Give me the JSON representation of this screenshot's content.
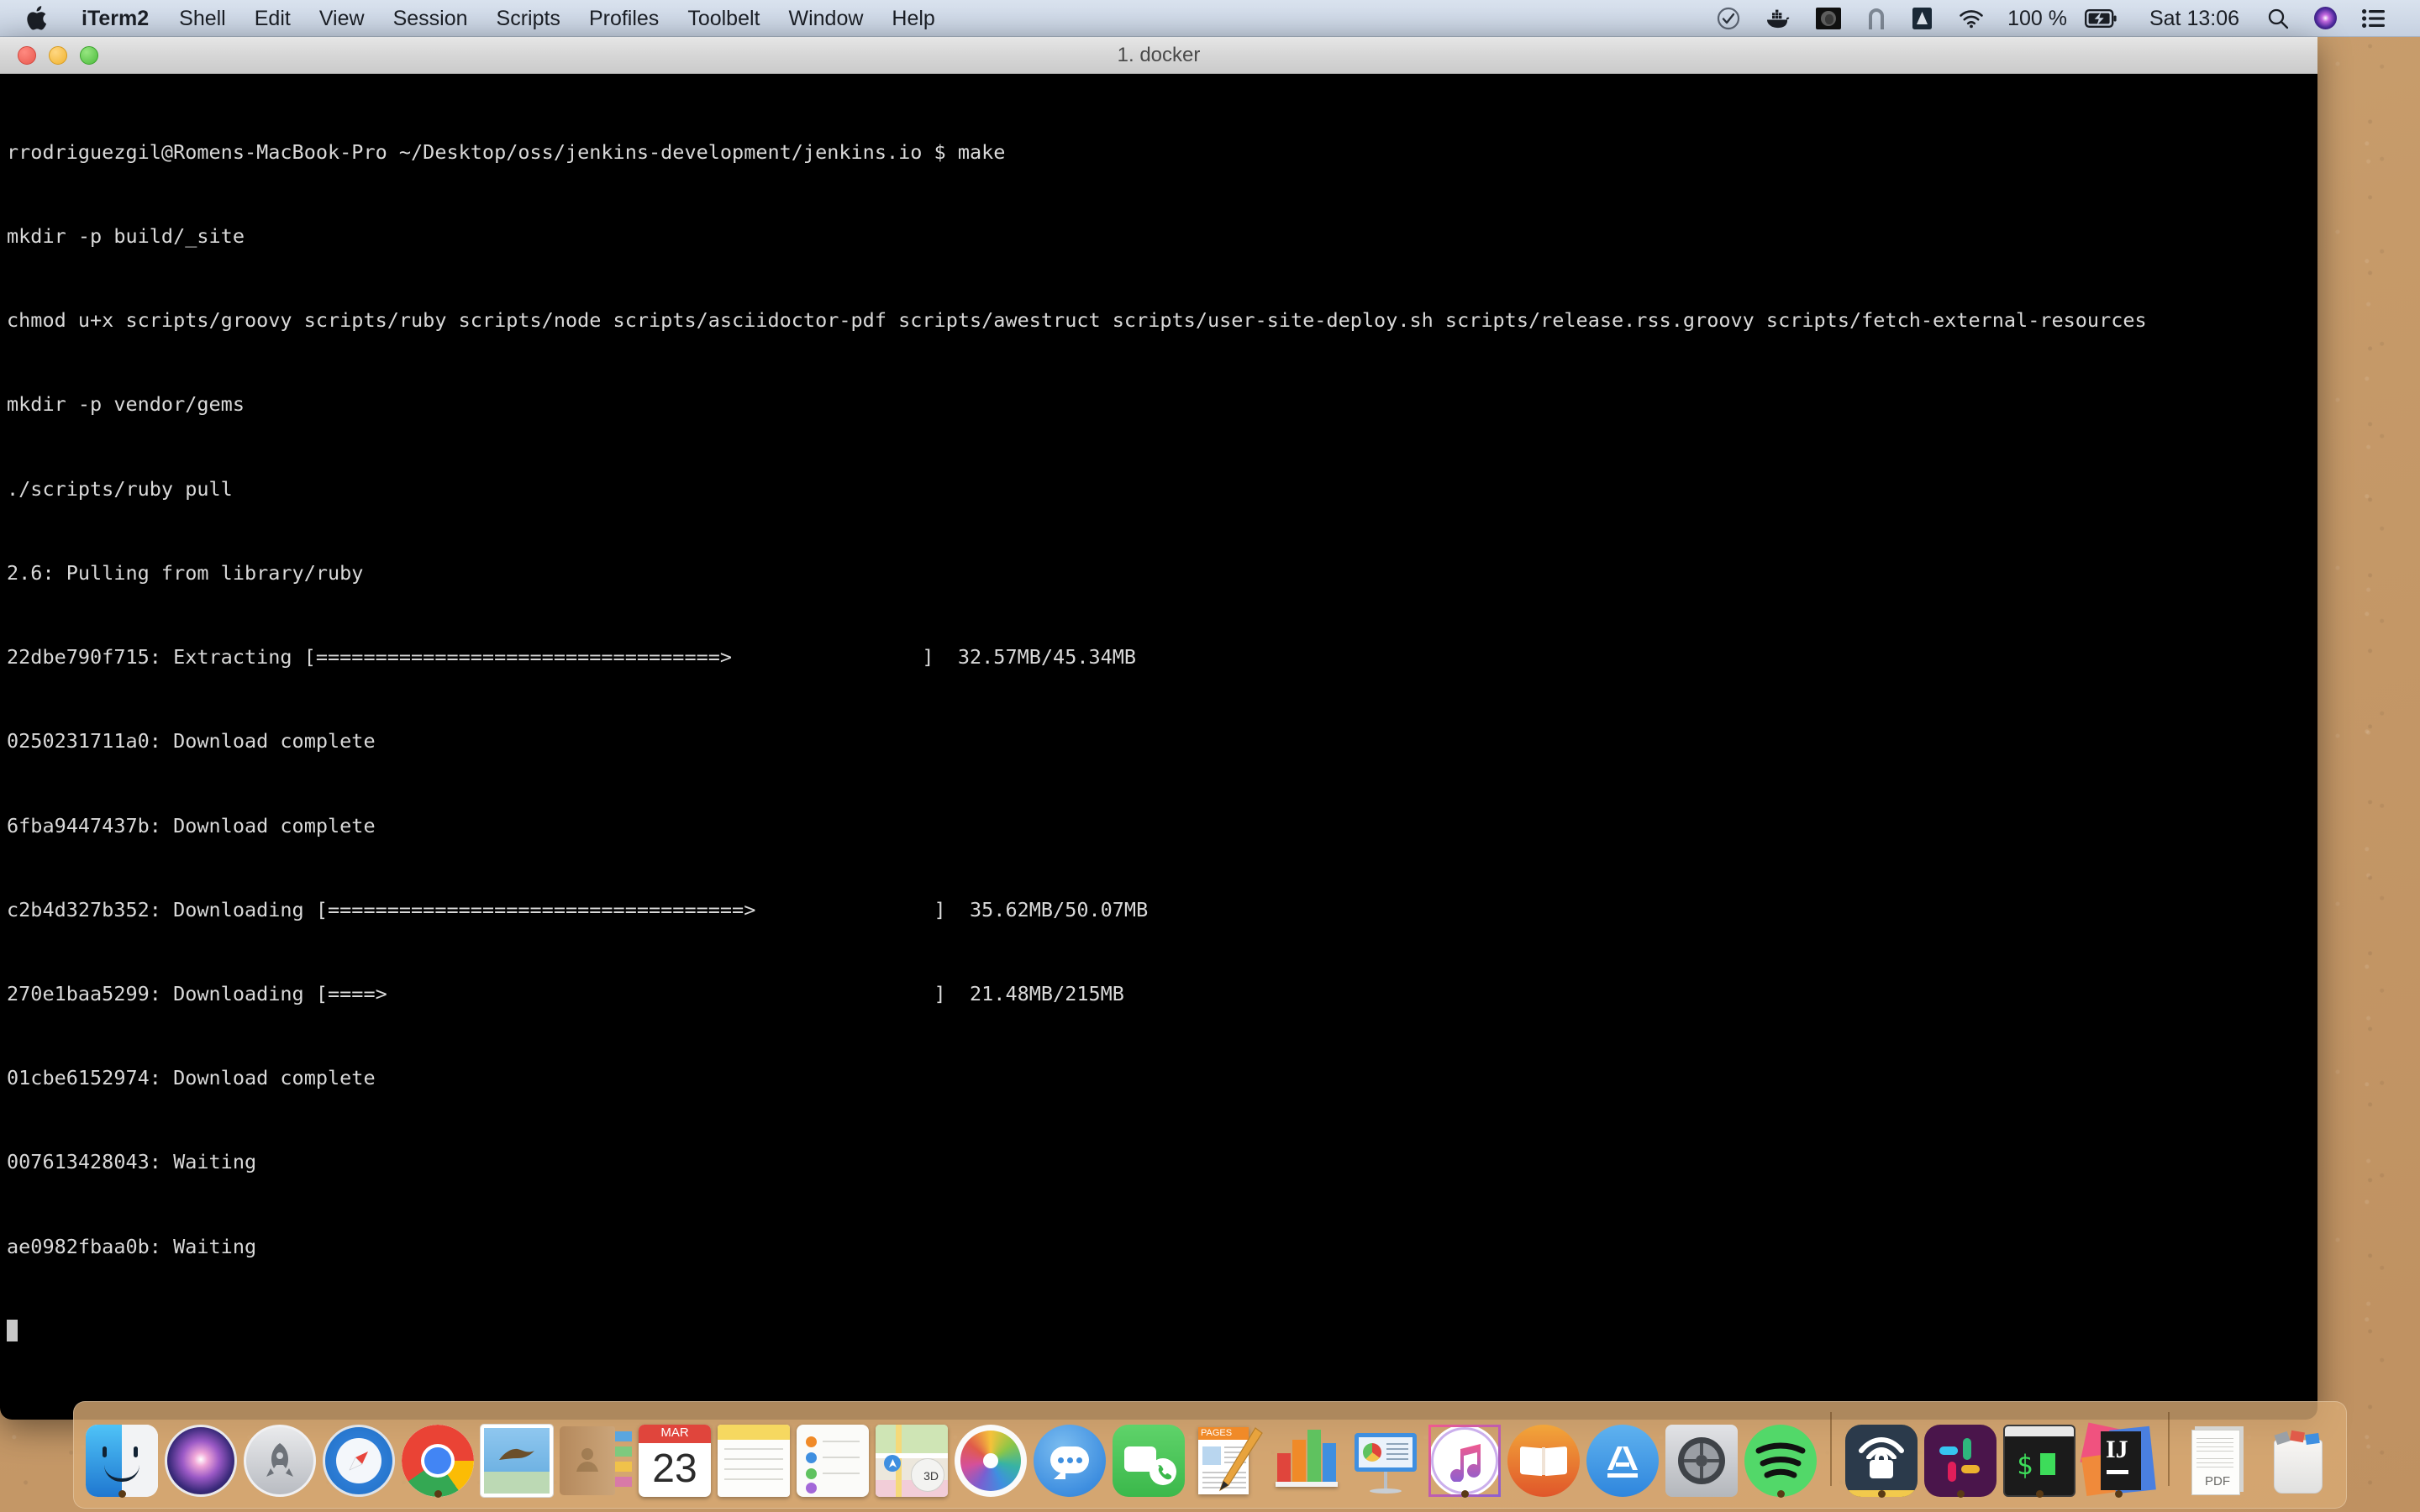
{
  "menubar": {
    "apple_icon": "apple-logo-icon",
    "app_name": "iTerm2",
    "items": [
      "Shell",
      "Edit",
      "View",
      "Session",
      "Scripts",
      "Profiles",
      "Toolbelt",
      "Window",
      "Help"
    ],
    "status_icons": [
      "tick-circle-icon",
      "docker-whale-icon",
      "screenshot-thumbnail-icon",
      "arc-browser-icon",
      "google-drive-icon",
      "wifi-icon"
    ],
    "battery_percent": "100 %",
    "battery_icon": "battery-charging-icon",
    "clock": "Sat 13:06",
    "search_icon": "spotlight-search-icon",
    "siri_icon": "siri-icon",
    "control_center_icon": "notification-center-icon"
  },
  "window": {
    "title": "1. docker",
    "close_button": "close-window-button",
    "minimize_button": "minimize-window-button",
    "zoom_button": "zoom-window-button"
  },
  "terminal": {
    "lines": [
      "rrodriguezgil@Romens-MacBook-Pro ~/Desktop/oss/jenkins-development/jenkins.io $ make",
      "mkdir -p build/_site",
      "chmod u+x scripts/groovy scripts/ruby scripts/node scripts/asciidoctor-pdf scripts/awestruct scripts/user-site-deploy.sh scripts/release.rss.groovy scripts/fetch-external-resources",
      "mkdir -p vendor/gems",
      "./scripts/ruby pull",
      "2.6: Pulling from library/ruby",
      "22dbe790f715: Extracting [==================================>                ]  32.57MB/45.34MB",
      "0250231711a0: Download complete",
      "6fba9447437b: Download complete",
      "c2b4d327b352: Downloading [===================================>               ]  35.62MB/50.07MB",
      "270e1baa5299: Downloading [====>                                              ]  21.48MB/215MB",
      "01cbe6152974: Download complete",
      "007613428043: Waiting",
      "ae0982fbaa0b: Waiting"
    ],
    "prompt_user_host": "rrodriguezgil@Romens-MacBook-Pro",
    "prompt_path": "~/Desktop/oss/jenkins-development/jenkins.io",
    "prompt_symbol": "$",
    "command": "make",
    "pull_image": "2.6",
    "pull_source": "library/ruby",
    "layers": [
      {
        "id": "22dbe790f715",
        "status": "Extracting",
        "progress_pct": 72,
        "downloaded": "32.57MB",
        "total": "45.34MB"
      },
      {
        "id": "0250231711a0",
        "status": "Download complete",
        "progress_pct": null,
        "downloaded": "",
        "total": ""
      },
      {
        "id": "6fba9447437b",
        "status": "Download complete",
        "progress_pct": null,
        "downloaded": "",
        "total": ""
      },
      {
        "id": "c2b4d327b352",
        "status": "Downloading",
        "progress_pct": 71,
        "downloaded": "35.62MB",
        "total": "50.07MB"
      },
      {
        "id": "270e1baa5299",
        "status": "Downloading",
        "progress_pct": 10,
        "downloaded": "21.48MB",
        "total": "215MB"
      },
      {
        "id": "01cbe6152974",
        "status": "Download complete",
        "progress_pct": null,
        "downloaded": "",
        "total": ""
      },
      {
        "id": "007613428043",
        "status": "Waiting",
        "progress_pct": null,
        "downloaded": "",
        "total": ""
      },
      {
        "id": "ae0982fbaa0b",
        "status": "Waiting",
        "progress_pct": null,
        "downloaded": "",
        "total": ""
      }
    ],
    "cursor": "block-cursor"
  },
  "dock": {
    "items": [
      {
        "name": "finder",
        "label": "Finder",
        "icon": "finder-icon",
        "running": true
      },
      {
        "name": "siri",
        "label": "Siri",
        "icon": "siri-icon",
        "running": false
      },
      {
        "name": "launchpad",
        "label": "Launchpad",
        "icon": "launchpad-icon",
        "running": false
      },
      {
        "name": "safari",
        "label": "Safari",
        "icon": "safari-compass-icon",
        "running": false
      },
      {
        "name": "chrome",
        "label": "Google Chrome",
        "icon": "chrome-icon",
        "running": true
      },
      {
        "name": "mail",
        "label": "Mail",
        "icon": "mail-stamp-icon",
        "running": false
      },
      {
        "name": "contacts",
        "label": "Contacts",
        "icon": "contacts-book-icon",
        "running": false
      },
      {
        "name": "calendar",
        "label": "Calendar",
        "icon": "calendar-icon",
        "running": false,
        "month": "MAR",
        "day": "23"
      },
      {
        "name": "notes",
        "label": "Notes",
        "icon": "notes-icon",
        "running": false
      },
      {
        "name": "reminders",
        "label": "Reminders",
        "icon": "reminders-icon",
        "running": false
      },
      {
        "name": "maps",
        "label": "Maps",
        "icon": "maps-icon",
        "running": false
      },
      {
        "name": "photos",
        "label": "Photos",
        "icon": "photos-pinwheel-icon",
        "running": false
      },
      {
        "name": "messages",
        "label": "Messages",
        "icon": "messages-bubble-icon",
        "running": false
      },
      {
        "name": "facetime",
        "label": "FaceTime",
        "icon": "facetime-icon",
        "running": false
      },
      {
        "name": "pages",
        "label": "Pages",
        "icon": "pages-icon",
        "running": false
      },
      {
        "name": "numbers",
        "label": "Numbers",
        "icon": "numbers-chart-icon",
        "running": false
      },
      {
        "name": "keynote",
        "label": "Keynote",
        "icon": "keynote-icon",
        "running": false
      },
      {
        "name": "itunes",
        "label": "iTunes",
        "icon": "itunes-note-icon",
        "running": true
      },
      {
        "name": "books",
        "label": "Books",
        "icon": "books-icon",
        "running": false
      },
      {
        "name": "app-store",
        "label": "App Store",
        "icon": "app-store-icon",
        "running": false
      },
      {
        "name": "system-preferences",
        "label": "System Preferences",
        "icon": "system-preferences-gear-icon",
        "running": false
      },
      {
        "name": "spotify",
        "label": "Spotify",
        "icon": "spotify-icon",
        "running": true
      },
      {
        "name": "vpn",
        "label": "VPN",
        "icon": "vpn-lock-wifi-icon",
        "running": true
      },
      {
        "name": "slack",
        "label": "Slack",
        "icon": "slack-icon",
        "running": true
      },
      {
        "name": "iterm2",
        "label": "iTerm2",
        "icon": "terminal-prompt-icon",
        "running": true
      },
      {
        "name": "intellij-idea",
        "label": "IntelliJ IDEA",
        "icon": "intellij-idea-icon",
        "running": true
      }
    ],
    "right_items": [
      {
        "name": "pdf-document",
        "label": "PDF Document",
        "icon": "pdf-document-icon"
      },
      {
        "name": "trash",
        "label": "Trash",
        "icon": "trash-full-icon"
      }
    ],
    "separator": "dock-separator"
  },
  "colors": {
    "menubar_bg": "#cfd9e7",
    "terminal_bg": "#000000",
    "terminal_fg": "#d9d9d9",
    "titlebar_bg": "#d6d6d6",
    "desktop_bg": "#c69a69",
    "dock_bg": "#d8aa74"
  }
}
